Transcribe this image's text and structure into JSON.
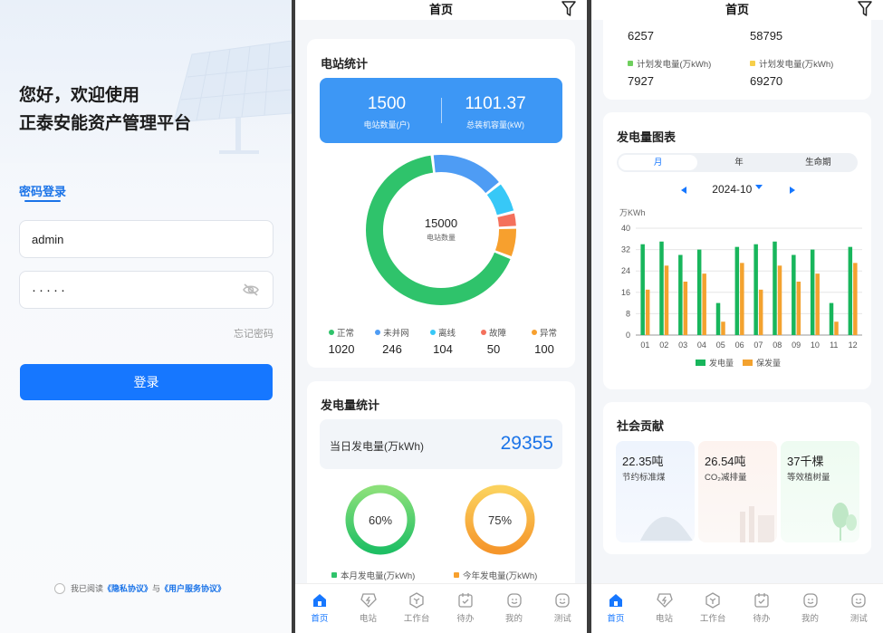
{
  "login": {
    "greeting_line1": "您好，欢迎使用",
    "greeting_line2": "正泰安能资产管理平台",
    "tab_label": "密码登录",
    "username_value": "admin",
    "password_mask": "·····",
    "forgot_label": "忘记密码",
    "login_button": "登录",
    "agree_prefix": "我已阅读",
    "privacy_link": "《隐私协议》",
    "agree_and": "与",
    "service_link": "《用户服务协议》"
  },
  "home": {
    "title": "首页",
    "station_card": {
      "title": "电站统计",
      "count_value": "1500",
      "count_label": "电站数量(户)",
      "capacity_value": "1101.37",
      "capacity_label": "总装机容量(kW)",
      "donut_center_value": "15000",
      "donut_center_label": "电站数量",
      "status": [
        {
          "label": "正常",
          "value": "1020",
          "color": "#2fc36b"
        },
        {
          "label": "未并网",
          "value": "246",
          "color": "#4e9cf4"
        },
        {
          "label": "离线",
          "value": "104",
          "color": "#37c8f7"
        },
        {
          "label": "故障",
          "value": "50",
          "color": "#f4705c"
        },
        {
          "label": "异常",
          "value": "100",
          "color": "#f7a02e"
        }
      ]
    },
    "power_card": {
      "title": "发电量统计",
      "day_label": "当日发电量(万kWh)",
      "day_value": "29355",
      "month_percent": "60%",
      "year_percent": "75%",
      "month_label": "本月发电量(万kWh)",
      "year_label": "今年发电量(万kWh)"
    },
    "plan": {
      "top_left_value": "6257",
      "top_right_value": "58795",
      "left_label": "计划发电量(万kWh)",
      "right_label": "计划发电量(万kWh)",
      "left_value": "7927",
      "right_value": "69270"
    },
    "chart_card": {
      "title": "发电量图表",
      "segments": [
        "月",
        "年",
        "生命期"
      ],
      "active_segment": "月",
      "period": "2024-10"
    },
    "social_card": {
      "title": "社会贡献",
      "tiles": [
        {
          "value": "22.35吨",
          "label": "节约标准煤"
        },
        {
          "value": "26.54吨",
          "label": "CO₂减排量"
        },
        {
          "value": "37千棵",
          "label": "等效植树量"
        }
      ]
    }
  },
  "tabbar": {
    "items": [
      {
        "label": "首页",
        "icon": "home-icon"
      },
      {
        "label": "电站",
        "icon": "station-icon"
      },
      {
        "label": "工作台",
        "icon": "workbench-icon"
      },
      {
        "label": "待办",
        "icon": "todo-icon"
      },
      {
        "label": "我的",
        "icon": "profile-icon"
      },
      {
        "label": "测试",
        "icon": "test-icon"
      }
    ]
  },
  "chart_data": {
    "type": "bar",
    "ylabel": "万KWh",
    "ylim": [
      0,
      40
    ],
    "yticks": [
      0,
      8,
      16,
      24,
      32,
      40
    ],
    "categories": [
      "01",
      "02",
      "03",
      "04",
      "05",
      "06",
      "07",
      "08",
      "09",
      "10",
      "11",
      "12"
    ],
    "series": [
      {
        "name": "发电量",
        "color": "#18b65c",
        "values": [
          34,
          35,
          30,
          32,
          12,
          33,
          34,
          35,
          30,
          32,
          12,
          33
        ]
      },
      {
        "name": "保发量",
        "color": "#f3a22f",
        "values": [
          17,
          26,
          20,
          23,
          5,
          27,
          17,
          26,
          20,
          23,
          5,
          27
        ]
      }
    ],
    "legend": "bottom",
    "grid": true
  }
}
